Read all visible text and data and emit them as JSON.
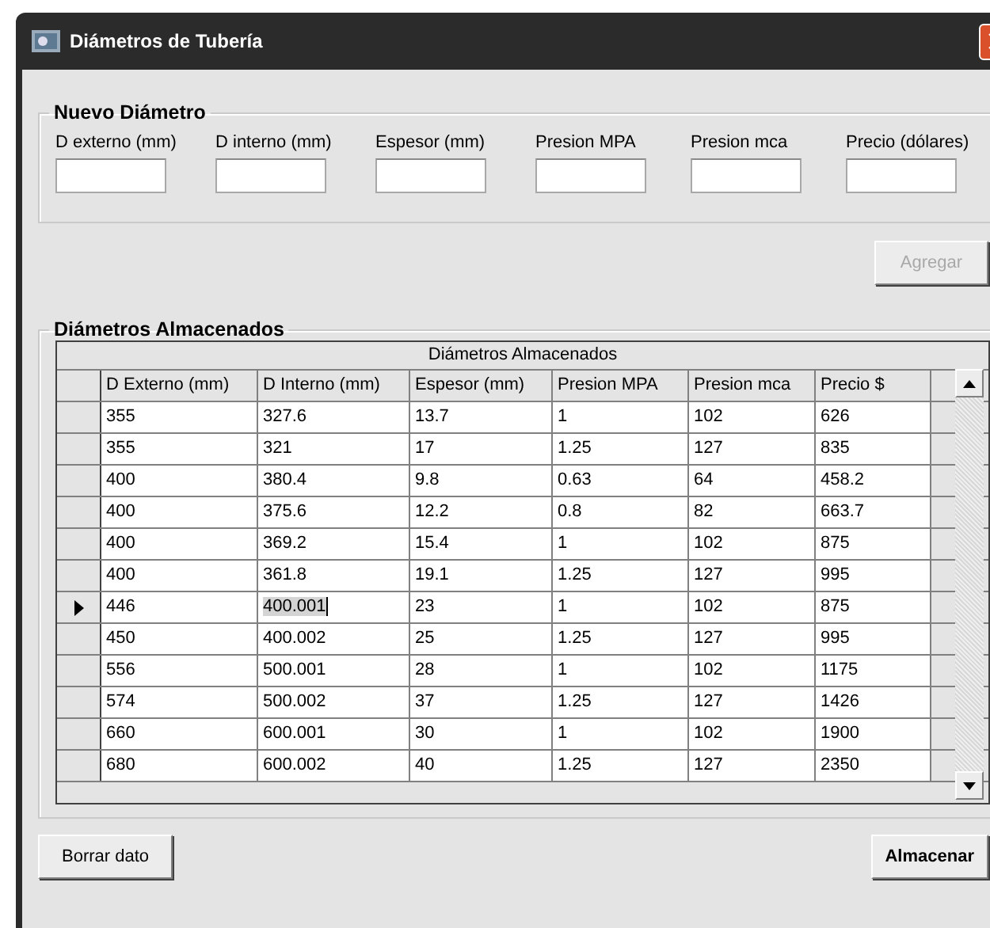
{
  "window": {
    "title": "Diámetros de Tubería"
  },
  "nuevo": {
    "title": "Nuevo Diámetro",
    "fields": [
      {
        "label": "D externo (mm)"
      },
      {
        "label": "D interno (mm)"
      },
      {
        "label": "Espesor (mm)"
      },
      {
        "label": "Presion MPA"
      },
      {
        "label": "Presion mca"
      },
      {
        "label": "Precio (dólares)"
      }
    ],
    "button": {
      "label": "Agregar",
      "disabled": true
    }
  },
  "almacenados": {
    "title": "Diámetros Almacenados",
    "table": {
      "caption": "Diámetros Almacenados",
      "columns": [
        "D Externo (mm)",
        "D Interno (mm)",
        "Espesor (mm)",
        "Presion MPA",
        "Presion mca",
        "Precio $"
      ],
      "rows": [
        {
          "selected": false,
          "cells": [
            {
              "text": "355",
              "selected": false
            },
            {
              "text": "327.6",
              "selected": false
            },
            {
              "text": "13.7",
              "selected": false
            },
            {
              "text": "1",
              "selected": false
            },
            {
              "text": "102",
              "selected": false
            },
            {
              "text": "626",
              "selected": false
            }
          ]
        },
        {
          "selected": false,
          "cells": [
            {
              "text": "355",
              "selected": false
            },
            {
              "text": "321",
              "selected": false
            },
            {
              "text": "17",
              "selected": false
            },
            {
              "text": "1.25",
              "selected": false
            },
            {
              "text": "127",
              "selected": false
            },
            {
              "text": "835",
              "selected": false
            }
          ]
        },
        {
          "selected": false,
          "cells": [
            {
              "text": "400",
              "selected": false
            },
            {
              "text": "380.4",
              "selected": false
            },
            {
              "text": "9.8",
              "selected": false
            },
            {
              "text": "0.63",
              "selected": false
            },
            {
              "text": "64",
              "selected": false
            },
            {
              "text": "458.2",
              "selected": false
            }
          ]
        },
        {
          "selected": false,
          "cells": [
            {
              "text": "400",
              "selected": false
            },
            {
              "text": "375.6",
              "selected": false
            },
            {
              "text": "12.2",
              "selected": false
            },
            {
              "text": "0.8",
              "selected": false
            },
            {
              "text": "82",
              "selected": false
            },
            {
              "text": "663.7",
              "selected": false
            }
          ]
        },
        {
          "selected": false,
          "cells": [
            {
              "text": "400",
              "selected": false
            },
            {
              "text": "369.2",
              "selected": false
            },
            {
              "text": "15.4",
              "selected": false
            },
            {
              "text": "1",
              "selected": false
            },
            {
              "text": "102",
              "selected": false
            },
            {
              "text": "875",
              "selected": false
            }
          ]
        },
        {
          "selected": false,
          "cells": [
            {
              "text": "400",
              "selected": false
            },
            {
              "text": "361.8",
              "selected": false
            },
            {
              "text": "19.1",
              "selected": false
            },
            {
              "text": "1.25",
              "selected": false
            },
            {
              "text": "127",
              "selected": false
            },
            {
              "text": "995",
              "selected": false
            }
          ]
        },
        {
          "selected": true,
          "cells": [
            {
              "text": "446",
              "selected": false
            },
            {
              "text": "400.001",
              "selected": true
            },
            {
              "text": "23",
              "selected": false
            },
            {
              "text": "1",
              "selected": false
            },
            {
              "text": "102",
              "selected": false
            },
            {
              "text": "875",
              "selected": false
            }
          ]
        },
        {
          "selected": false,
          "cells": [
            {
              "text": "450",
              "selected": false
            },
            {
              "text": "400.002",
              "selected": false
            },
            {
              "text": "25",
              "selected": false
            },
            {
              "text": "1.25",
              "selected": false
            },
            {
              "text": "127",
              "selected": false
            },
            {
              "text": "995",
              "selected": false
            }
          ]
        },
        {
          "selected": false,
          "cells": [
            {
              "text": "556",
              "selected": false
            },
            {
              "text": "500.001",
              "selected": false
            },
            {
              "text": "28",
              "selected": false
            },
            {
              "text": "1",
              "selected": false
            },
            {
              "text": "102",
              "selected": false
            },
            {
              "text": "1175",
              "selected": false
            }
          ]
        },
        {
          "selected": false,
          "cells": [
            {
              "text": "574",
              "selected": false
            },
            {
              "text": "500.002",
              "selected": false
            },
            {
              "text": "37",
              "selected": false
            },
            {
              "text": "1.25",
              "selected": false
            },
            {
              "text": "127",
              "selected": false
            },
            {
              "text": "1426",
              "selected": false
            }
          ]
        },
        {
          "selected": false,
          "cells": [
            {
              "text": "660",
              "selected": false
            },
            {
              "text": "600.001",
              "selected": false
            },
            {
              "text": "30",
              "selected": false
            },
            {
              "text": "1",
              "selected": false
            },
            {
              "text": "102",
              "selected": false
            },
            {
              "text": "1900",
              "selected": false
            }
          ]
        },
        {
          "selected": false,
          "cells": [
            {
              "text": "680",
              "selected": false
            },
            {
              "text": "600.002",
              "selected": false
            },
            {
              "text": "40",
              "selected": false
            },
            {
              "text": "1.25",
              "selected": false
            },
            {
              "text": "127",
              "selected": false
            },
            {
              "text": "2350",
              "selected": false
            }
          ]
        }
      ]
    }
  },
  "buttons": [
    {
      "label": "Borrar dato",
      "kind": "normal"
    },
    {
      "label": "Almacenar",
      "kind": "default"
    }
  ]
}
